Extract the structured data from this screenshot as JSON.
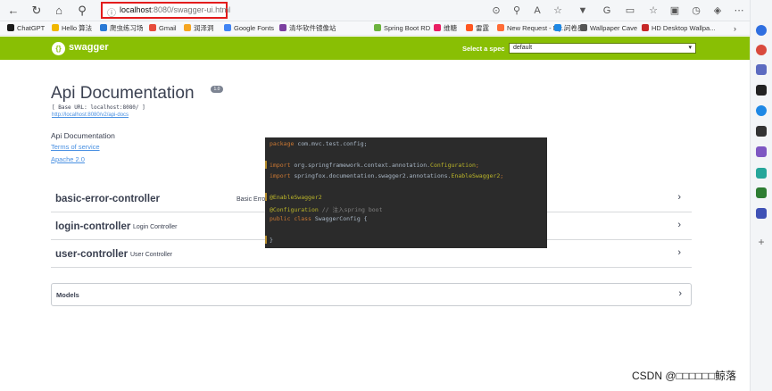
{
  "browser": {
    "url_host": "localhost",
    "url_rest": ":8080/swagger-ui.html"
  },
  "bookmarks": [
    {
      "label": "ChatGPT",
      "color": "#1a1a1a"
    },
    {
      "label": "Hello 算法",
      "color": "#f1b700"
    },
    {
      "label": "爬虫练习场",
      "color": "#2a7ad6"
    },
    {
      "label": "Gmail",
      "color": "#e74c3c"
    },
    {
      "label": "润泽洞",
      "color": "#f5a623"
    },
    {
      "label": "Google Fonts",
      "color": "#4285f4"
    },
    {
      "label": "清华软件镜像站",
      "color": "#7b3fa0"
    },
    {
      "label": "Spring Boot RD",
      "color": "#6db33f"
    },
    {
      "label": "维糖",
      "color": "#e91e63"
    },
    {
      "label": "雷霆",
      "color": "#ff5722"
    },
    {
      "label": "New Request - My...",
      "color": "#ff6c37"
    },
    {
      "label": "问卷星",
      "color": "#1e88e5"
    },
    {
      "label": "Wallpaper Cave",
      "color": "#555555"
    },
    {
      "label": "HD Desktop Wallpa...",
      "color": "#c62828"
    }
  ],
  "header": {
    "logo_text": "swagger",
    "spec_label": "Select a spec",
    "spec_value": "default"
  },
  "info": {
    "title": "Api Documentation",
    "version": "1.0",
    "base_url": "[ Base URL: localhost:8080/ ]",
    "docs_link": "http://localhost:8080/v2/api-docs",
    "description": "Api Documentation",
    "terms": "Terms of service",
    "license": "Apache 2.0"
  },
  "controllers": [
    {
      "name": "basic-error-controller",
      "description": "Basic Error Controller"
    },
    {
      "name": "login-controller",
      "description": "Login Controller"
    },
    {
      "name": "user-controller",
      "description": "User Controller"
    }
  ],
  "models": {
    "label": "Models"
  },
  "code": {
    "l1_kw": "package",
    "l1_rest": " com.mvc.test.config;",
    "l2_kw": "import",
    "l2_rest": " org.springframework.context.annotation.",
    "l2_cls": "Configuration",
    "l3_kw": "import",
    "l3_rest": " springfox.documentation.swagger2.annotations.",
    "l3_cls": "EnableSwagger2",
    "l4": "@EnableSwagger2",
    "l5": "@Configuration",
    "l5_comment": "  // 注入spring boot",
    "l6_kw": "public class",
    "l6_rest": " SwaggerConfig {",
    "l7": "}"
  },
  "watermark": "CSDN @□□□□□□鲸落"
}
